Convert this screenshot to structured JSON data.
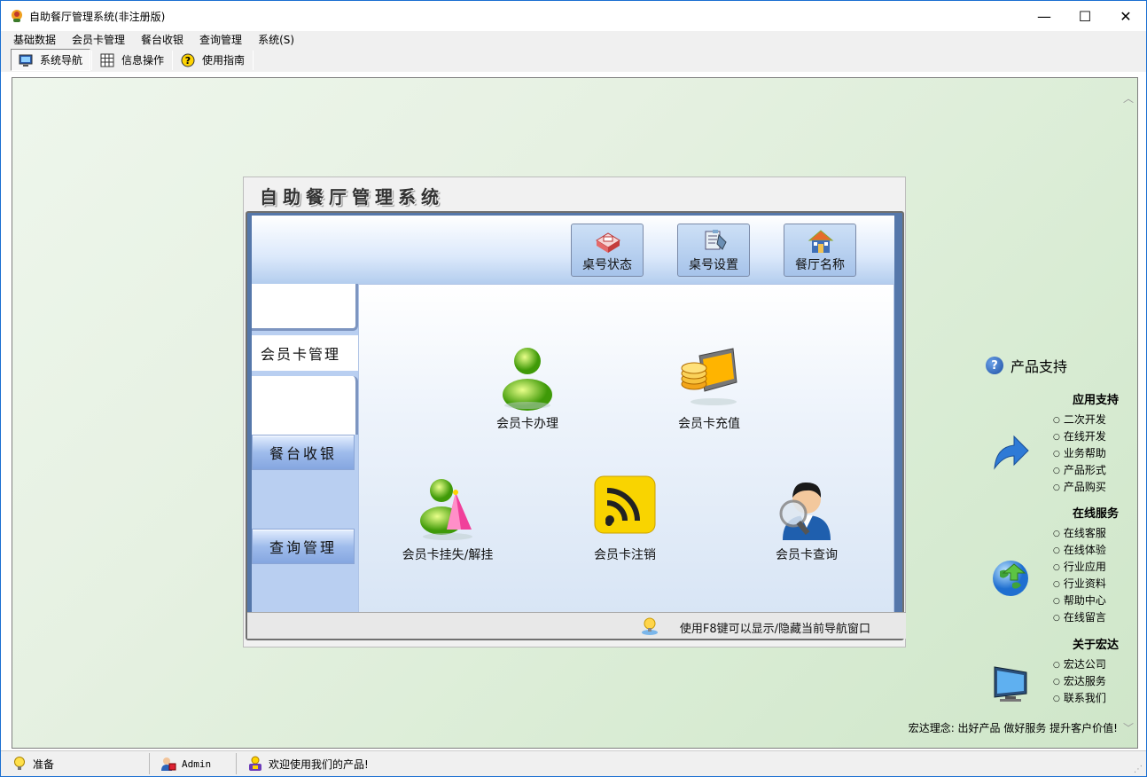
{
  "window": {
    "title": "自助餐厅管理系统(非注册版)",
    "controls": {
      "minimize": "—",
      "maximize": "☐",
      "close": "✕"
    }
  },
  "menubar": {
    "items": [
      "基础数据",
      "会员卡管理",
      "餐台收银",
      "查询管理",
      "系统(S)"
    ]
  },
  "toolbar": {
    "items": [
      {
        "label": "系统导航",
        "icon": "monitor-icon",
        "active": true
      },
      {
        "label": "信息操作",
        "icon": "grid-icon",
        "active": false
      },
      {
        "label": "使用指南",
        "icon": "help-icon",
        "active": false
      }
    ]
  },
  "panel": {
    "title": "自助餐厅管理系统",
    "top_buttons": [
      {
        "label": "桌号状态",
        "icon": "table-status-icon"
      },
      {
        "label": "桌号设置",
        "icon": "table-settings-icon"
      },
      {
        "label": "餐厅名称",
        "icon": "restaurant-name-icon"
      }
    ],
    "sidebar": {
      "active_tab": "会员卡管理",
      "buttons": [
        "餐台收银",
        "查询管理"
      ]
    },
    "functions": [
      {
        "label": "会员卡办理",
        "icon": "member-card-issue-icon"
      },
      {
        "label": "会员卡充值",
        "icon": "member-card-recharge-icon"
      },
      {
        "label": "会员卡挂失/解挂",
        "icon": "member-card-loss-icon"
      },
      {
        "label": "会员卡注销",
        "icon": "member-card-cancel-icon"
      },
      {
        "label": "会员卡查询",
        "icon": "member-card-query-icon"
      }
    ],
    "hint": "使用F8键可以显示/隐藏当前导航窗口"
  },
  "support": {
    "title": "产品支持",
    "sections": [
      {
        "head": "应用支持",
        "icon": "arrow-icon",
        "items": [
          "二次开发",
          "在线开发",
          "业务帮助",
          "产品形式",
          "产品购买"
        ]
      },
      {
        "head": "在线服务",
        "icon": "globe-icon",
        "items": [
          "在线客服",
          "在线体验",
          "行业应用",
          "行业资料",
          "帮助中心",
          "在线留言"
        ]
      },
      {
        "head": "关于宏达",
        "icon": "computer-icon",
        "items": [
          "宏达公司",
          "宏达服务",
          "联系我们"
        ]
      }
    ],
    "motto": "宏达理念: 出好产品  做好服务  提升客户价值!"
  },
  "statusbar": {
    "status": "准备",
    "user": "Admin",
    "welcome": "欢迎使用我们的产品!"
  }
}
